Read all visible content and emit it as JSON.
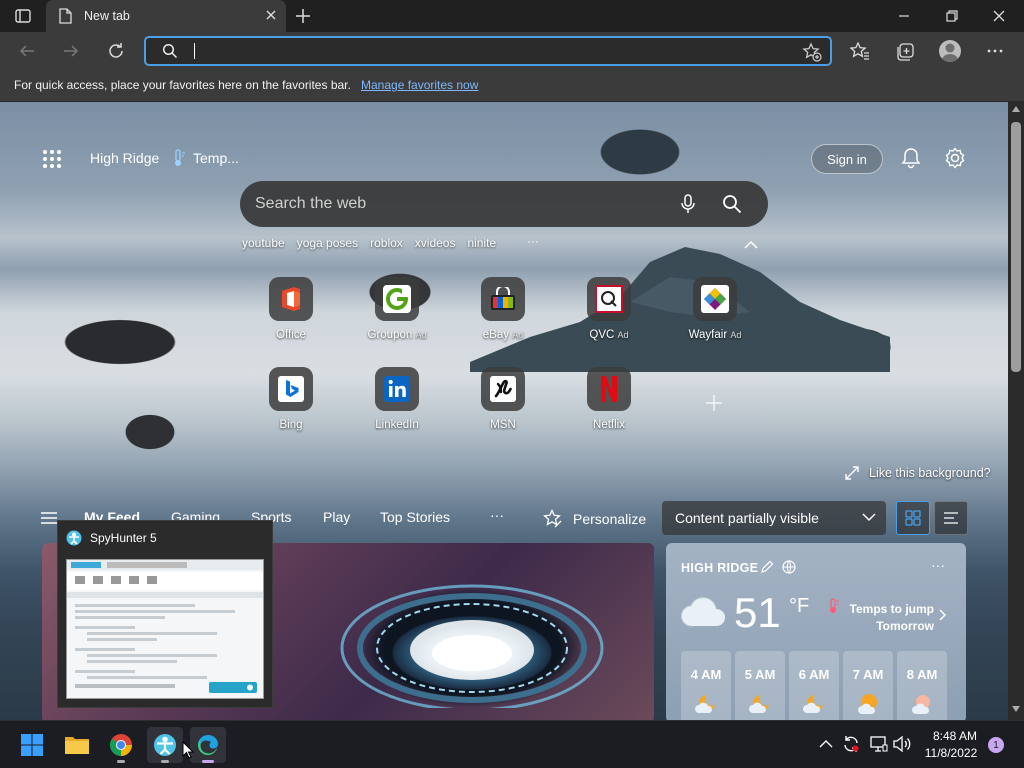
{
  "browser": {
    "tab_title": "New tab",
    "address_placeholder": "",
    "favorites_bar_text": "For quick access, place your favorites here on the favorites bar.",
    "favorites_bar_link": "Manage favorites now"
  },
  "newtab": {
    "location": "High Ridge",
    "temp_label": "Temp...",
    "sign_in": "Sign in",
    "search_placeholder": "Search the web",
    "trending": [
      "youtube",
      "yoga poses",
      "roblox",
      "xvideos",
      "ninite"
    ],
    "trending_more": "···",
    "quick_links": [
      {
        "label": "Office",
        "ad": "",
        "icon": "office-icon",
        "color": "#e8492b"
      },
      {
        "label": "Groupon",
        "ad": "Ad",
        "icon": "groupon-icon",
        "color": "#53a318"
      },
      {
        "label": "eBay",
        "ad": "Ad",
        "icon": "ebay-icon",
        "color": "#e53238"
      },
      {
        "label": "QVC",
        "ad": "Ad",
        "icon": "qvc-icon",
        "color": "#c8102e"
      },
      {
        "label": "Wayfair",
        "ad": "Ad",
        "icon": "wayfair-icon",
        "color": "#7f187f"
      },
      {
        "label": "Bing",
        "ad": "",
        "icon": "bing-icon",
        "color": "#0b72d8"
      },
      {
        "label": "LinkedIn",
        "ad": "",
        "icon": "linkedin-icon",
        "color": "#0a66c2"
      },
      {
        "label": "MSN",
        "ad": "",
        "icon": "msn-icon",
        "color": "#000000"
      },
      {
        "label": "Netflix",
        "ad": "",
        "icon": "netflix-icon",
        "color": "#e50914"
      }
    ],
    "like_background": "Like this background?",
    "feed_tabs": [
      "My Feed",
      "Gaming",
      "Sports",
      "Play",
      "Top Stories"
    ],
    "feed_more": "···",
    "personalize": "Personalize",
    "content_visibility": "Content partially visible"
  },
  "weather": {
    "location": "HIGH RIDGE",
    "temperature": "51",
    "unit": "°F",
    "alert_line1": "Temps to jump",
    "alert_line2": "Tomorrow",
    "more": "···",
    "hours": [
      {
        "time": "4 AM",
        "icon": "moon-cloud-icon"
      },
      {
        "time": "5 AM",
        "icon": "moon-cloud-icon"
      },
      {
        "time": "6 AM",
        "icon": "moon-cloud-icon"
      },
      {
        "time": "7 AM",
        "icon": "sun-cloud-icon"
      },
      {
        "time": "8 AM",
        "icon": "sun-cloud-icon"
      }
    ]
  },
  "taskbar": {
    "preview_title": "SpyHunter 5",
    "clock_time": "8:48 AM",
    "clock_date": "11/8/2022",
    "notification_count": "1"
  },
  "colors": {
    "accent": "#4a9fe8",
    "link": "#7fb8ff",
    "edge_indicator": "#c8a7f0"
  }
}
